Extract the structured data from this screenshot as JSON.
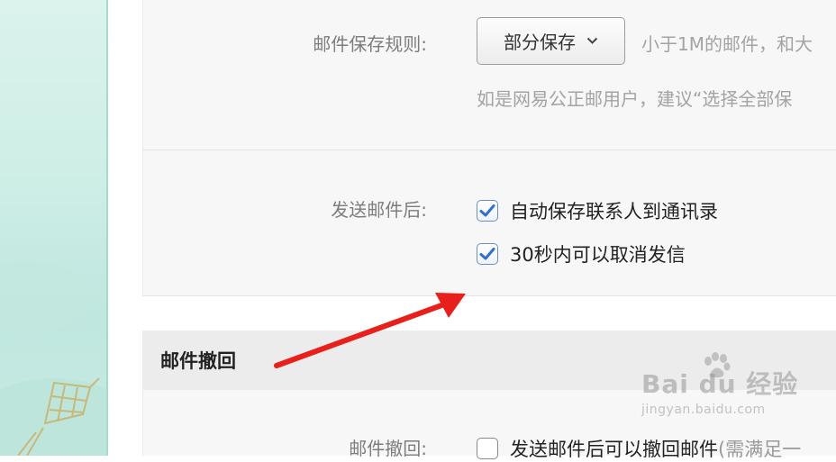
{
  "settings": {
    "save_rule": {
      "label": "邮件保存规则:",
      "select_value": "部分保存",
      "hint_inline": "小于1M的邮件，和大",
      "hint_below": "如是网易公正邮用户，建议“选择全部保"
    },
    "after_send": {
      "label": "发送邮件后:",
      "options": [
        {
          "label": "自动保存联系人到通讯录",
          "checked": true
        },
        {
          "label": "30秒内可以取消发信",
          "checked": true
        }
      ]
    }
  },
  "recall_section": {
    "title": "邮件撤回",
    "label": "邮件撤回:",
    "option_label": "发送邮件后可以撤回邮件",
    "option_note": "(需满足一",
    "checked": false
  },
  "watermark": {
    "brand": "Bai du 经验",
    "url": "jingyan.baidu.com"
  },
  "colors": {
    "arrow": "#e8201c",
    "check": "#2f6fd0",
    "panel": "#f7f7f7"
  }
}
